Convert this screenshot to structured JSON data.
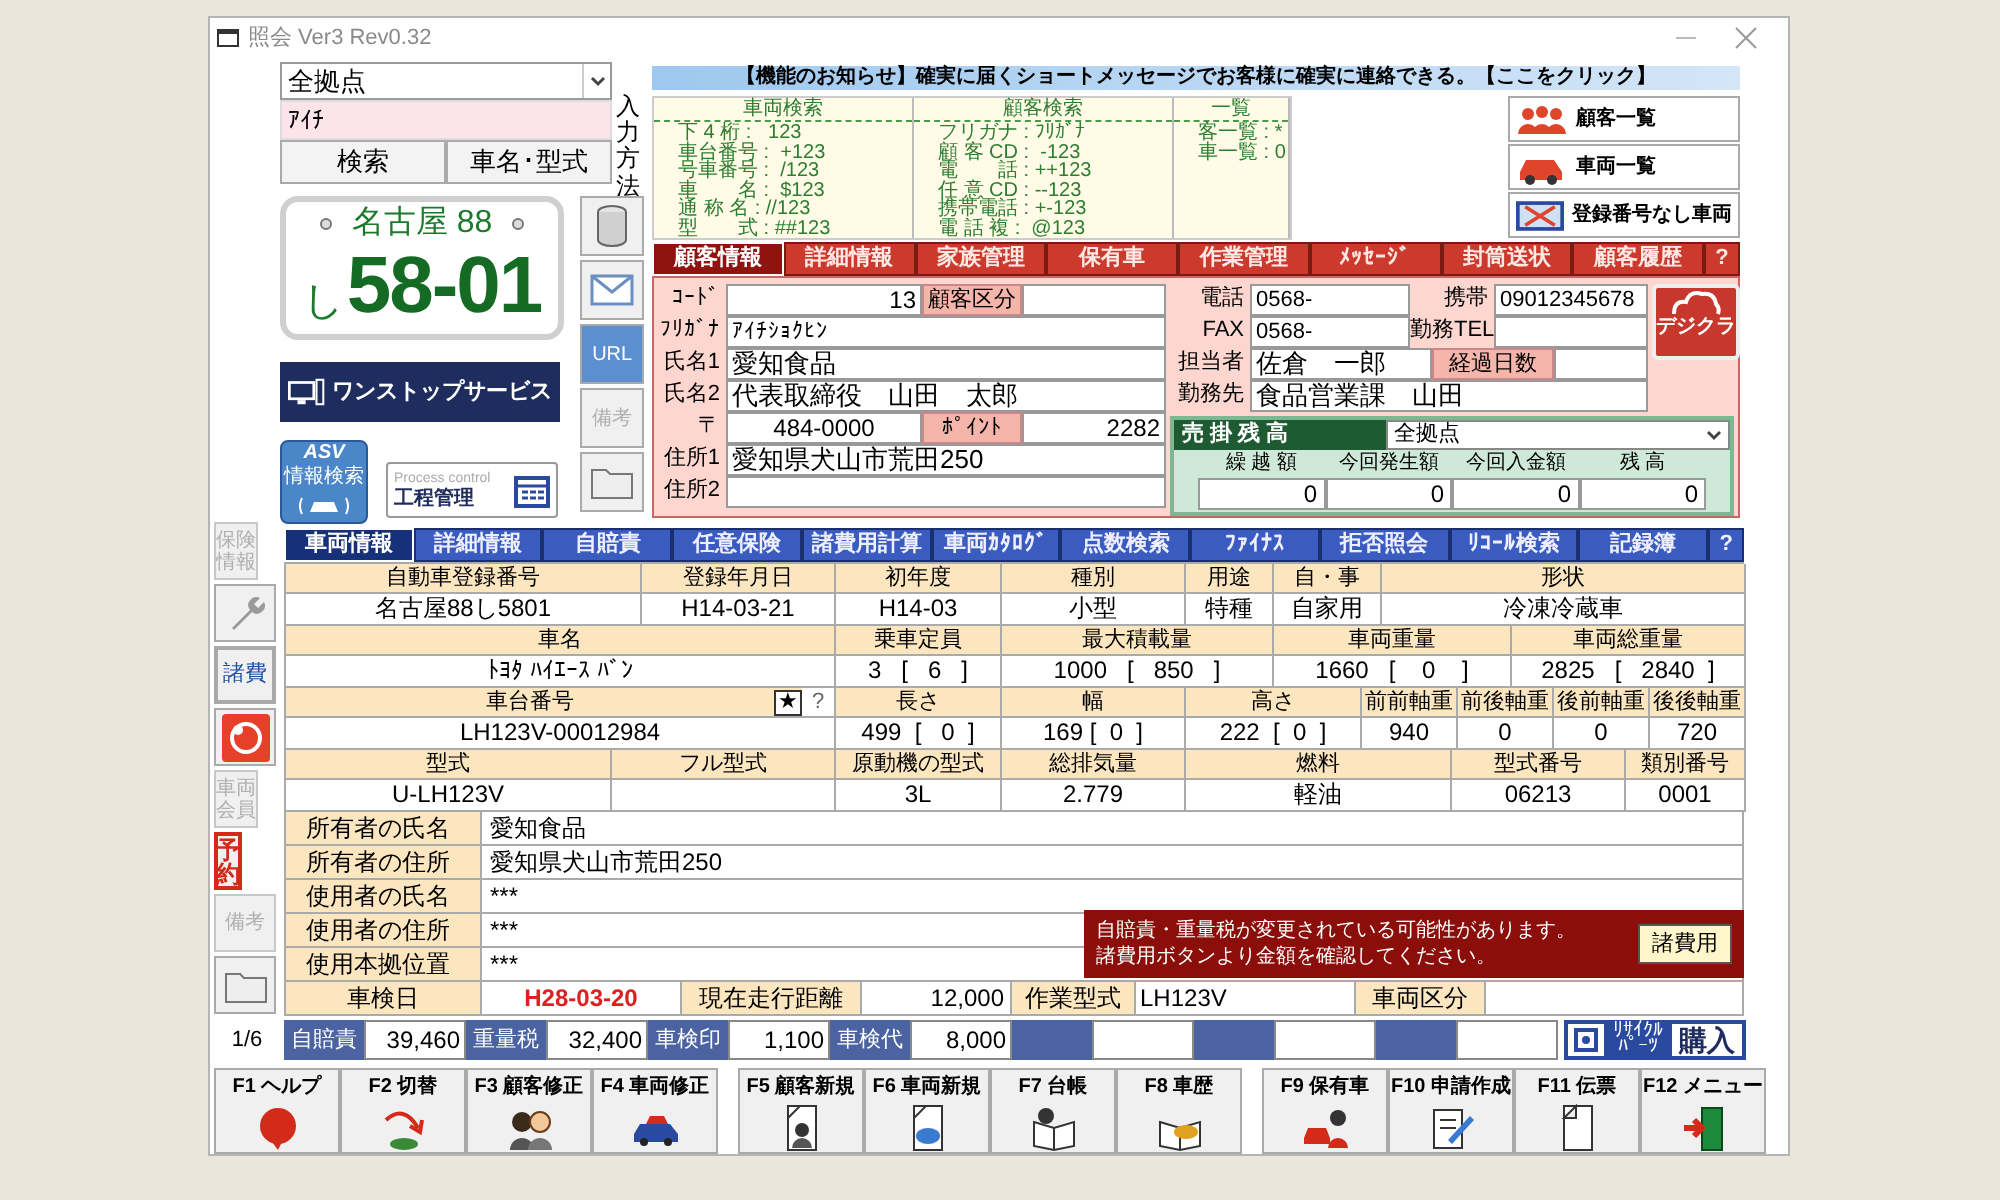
{
  "window": {
    "title": "照会 Ver3 Rev0.32"
  },
  "search": {
    "branch": "全拠点",
    "query": "ｱｲﾁ",
    "buttons": [
      "検索",
      "車名･型式"
    ],
    "input_method_label": "入力方法"
  },
  "plate": {
    "region": "名古屋 88",
    "kana": "し",
    "number": "58-01"
  },
  "one_stop_button": "ワンストップサービス",
  "asv_button": {
    "title": "ASV",
    "caption": "情報検索"
  },
  "process_button": {
    "caption": "Process control",
    "label": "工程管理"
  },
  "top_tools": [
    {
      "kind": "icon",
      "disabled": false
    },
    {
      "kind": "icon",
      "disabled": false
    },
    {
      "kind": "label",
      "text": "URL",
      "disabled": false
    },
    {
      "kind": "label",
      "text": "備考",
      "disabled": true
    },
    {
      "kind": "icon",
      "disabled": false
    }
  ],
  "notice": "【機能のお知らせ】確実に届くショートメッセージでお客様に確実に連絡できる。【ここをクリック】",
  "search_help": [
    {
      "title": "車両検索",
      "lines": [
        "下 4 桁 :   123",
        "車台番号 :  +123",
        "号車番号 :  /123",
        "車　　名 :  $123",
        "通 称 名 : //123",
        "型　　式 : ##123"
      ]
    },
    {
      "title": "顧客検索",
      "lines": [
        "フリガナ : ﾌﾘｶﾞﾅ",
        "顧 客 CD :  -123",
        "電　　話 : ++123",
        "任 意 CD : --123",
        "携帯電話 : +-123",
        "電 話 複 :  @123"
      ]
    },
    {
      "title": "一覧",
      "lines": [
        "客一覧 : *",
        "車一覧 : 0"
      ]
    }
  ],
  "list_buttons": [
    {
      "label": "顧客一覧"
    },
    {
      "label": "車両一覧"
    },
    {
      "label": "登録番号なし車両"
    }
  ],
  "customer_tabs": [
    {
      "label": "顧客情報",
      "selected": true
    },
    {
      "label": "詳細情報",
      "selected": false
    },
    {
      "label": "家族管理",
      "selected": false
    },
    {
      "label": "保有車",
      "selected": false
    },
    {
      "label": "作業管理",
      "selected": false
    },
    {
      "label": "ﾒｯｾｰｼﾞ",
      "selected": false
    },
    {
      "label": "封筒送状",
      "selected": false
    },
    {
      "label": "顧客履歴",
      "selected": false
    },
    {
      "label": "?",
      "selected": false
    }
  ],
  "customer": {
    "code": {
      "label": "ｺｰﾄﾞ",
      "value": "13"
    },
    "category": {
      "label": "顧客区分"
    },
    "furigana": {
      "label": "ﾌﾘｶﾞﾅ",
      "value": "ｱｲﾁｼｮｸﾋﾝ"
    },
    "name1": {
      "label": "氏名1",
      "value": "愛知食品"
    },
    "name2": {
      "label": "氏名2",
      "value": "代表取締役　山田　太郎"
    },
    "postal": {
      "label": "〒",
      "value": "484-0000"
    },
    "points": {
      "label": "ﾎﾟｲﾝﾄ",
      "value": "2282"
    },
    "address1": {
      "label": "住所1",
      "value": "愛知県犬山市荒田250"
    },
    "address2": {
      "label": "住所2"
    },
    "phone": {
      "label": "電話",
      "value": "0568-"
    },
    "mobile": {
      "label": "携帯",
      "value": "09012345678"
    },
    "fax": {
      "label": "FAX",
      "value": "0568-"
    },
    "work_tel": {
      "label": "勤務TEL"
    },
    "staff": {
      "label": "担当者",
      "value": "佐倉　一郎"
    },
    "elapsed_days": {
      "label": "経過日数"
    },
    "workplace": {
      "label": "勤務先",
      "value": "食品営業課　山田"
    },
    "logo": "デジクラ",
    "receivables": {
      "title": "売 掛 残 高",
      "branch": "全拠点",
      "columns": [
        "繰 越 額",
        "今回発生額",
        "今回入金額",
        "残 高"
      ],
      "values": [
        "0",
        "0",
        "0",
        "0"
      ]
    }
  },
  "side_tools": [
    {
      "kind": "label",
      "text": "保険情報",
      "disabled": true
    },
    {
      "kind": "icon",
      "disabled": false
    },
    {
      "kind": "label",
      "text": "諸費",
      "disabled": false
    },
    {
      "kind": "icon",
      "disabled": false
    },
    {
      "kind": "label",
      "text": "車両会員",
      "disabled": true
    },
    {
      "kind": "label",
      "text": "予約",
      "disabled": false
    },
    {
      "kind": "label",
      "text": "備考",
      "disabled": true
    },
    {
      "kind": "icon",
      "disabled": false
    }
  ],
  "vehicle_tabs": [
    {
      "label": "車両情報",
      "selected": true
    },
    {
      "label": "詳細情報",
      "selected": false
    },
    {
      "label": "自賠責",
      "selected": false
    },
    {
      "label": "任意保険",
      "selected": false
    },
    {
      "label": "諸費用計算",
      "selected": false
    },
    {
      "label": "車両ｶﾀﾛｸﾞ",
      "selected": false
    },
    {
      "label": "点数検索",
      "selected": false
    },
    {
      "label": "ﾌｧｲﾅｽ",
      "selected": false
    },
    {
      "label": "拒否照会",
      "selected": false
    },
    {
      "label": "ﾘｺｰﾙ検索",
      "selected": false
    },
    {
      "label": "記録簿",
      "selected": false
    },
    {
      "label": "?",
      "selected": false
    }
  ],
  "vehicle_grid": [
    {
      "kind": "header",
      "cells": [
        "自動車登録番号",
        "登録年月日",
        "初年度",
        "種別",
        "用途",
        "自・事",
        "形状"
      ]
    },
    {
      "kind": "values",
      "cells": [
        "名古屋88し5801",
        "H14-03-21",
        "H14-03",
        "小型",
        "特種",
        "自家用",
        "冷凍冷蔵車"
      ]
    },
    {
      "kind": "header",
      "cells": [
        "車名",
        "乗車定員",
        "最大積載量",
        "車両重量",
        "車両総重量"
      ]
    },
    {
      "kind": "values",
      "cells": [
        "ﾄﾖﾀ ﾊｲｴｰｽ ﾊﾞﾝ",
        "3   [   6   ]",
        "1000   [   850   ]",
        "1660   [    0    ]",
        "2825   [   2840  ]"
      ]
    },
    {
      "kind": "header",
      "cells": [
        "車台番号",
        "長さ",
        "幅",
        "高さ",
        "前前軸重",
        "前後軸重",
        "後前軸重",
        "後後軸重"
      ],
      "marks": [
        "★",
        "?"
      ]
    },
    {
      "kind": "values",
      "cells": [
        "LH123V-00012984",
        "499  [   0  ]",
        "169 [  0  ]",
        "222  [  0  ]",
        "940",
        "0",
        "0",
        "720"
      ]
    },
    {
      "kind": "header",
      "cells": [
        "型式",
        "フル型式",
        "原動機の型式",
        "総排気量",
        "燃料",
        "型式番号",
        "類別番号"
      ]
    },
    {
      "kind": "values",
      "cells": [
        "U-LH123V",
        null,
        "3L",
        "2.779",
        "軽油",
        "06213",
        "0001"
      ]
    }
  ],
  "owner_rows": [
    {
      "label": "所有者の氏名",
      "value": "愛知食品"
    },
    {
      "label": "所有者の住所",
      "value": "愛知県犬山市荒田250"
    },
    {
      "label": "使用者の氏名",
      "value": "***"
    },
    {
      "label": "使用者の住所",
      "value": "***"
    },
    {
      "label": "使用本拠位置",
      "value": "***"
    }
  ],
  "warning": {
    "lines": [
      "自賠責・重量税が変更されている可能性があります。",
      "諸費用ボタンより金額を確認してください。"
    ],
    "button": "諸費用"
  },
  "inspection_row": [
    {
      "label": "車検日",
      "value": "H28-03-20"
    },
    {
      "label": "現在走行距離",
      "value": "12,000"
    },
    {
      "label": "作業型式",
      "value": "LH123V"
    },
    {
      "label": "車両区分"
    }
  ],
  "page_indicator": "1/6",
  "fees": [
    {
      "label": "自賠責",
      "value": "39,460"
    },
    {
      "label": "重量税",
      "value": "32,400"
    },
    {
      "label": "車検印",
      "value": "1,100"
    },
    {
      "label": "車検代",
      "value": "8,000"
    }
  ],
  "recycle_button": {
    "tag_lines": [
      "ﾘｻｲｸﾙ",
      "ﾊﾟｰﾂ"
    ],
    "label": "購入"
  },
  "function_keys": [
    {
      "label": "F1 ヘルプ"
    },
    {
      "label": "F2 切替"
    },
    {
      "label": "F3 顧客修正"
    },
    {
      "label": "F4 車両修正"
    },
    {
      "label": "F5 顧客新規"
    },
    {
      "label": "F6 車両新規"
    },
    {
      "label": "F7 台帳"
    },
    {
      "label": "F8 車歴"
    },
    {
      "label": "F9 保有車"
    },
    {
      "label": "F10 申請作成"
    },
    {
      "label": "F11 伝票"
    },
    {
      "label": "F12 メニュー"
    }
  ]
}
